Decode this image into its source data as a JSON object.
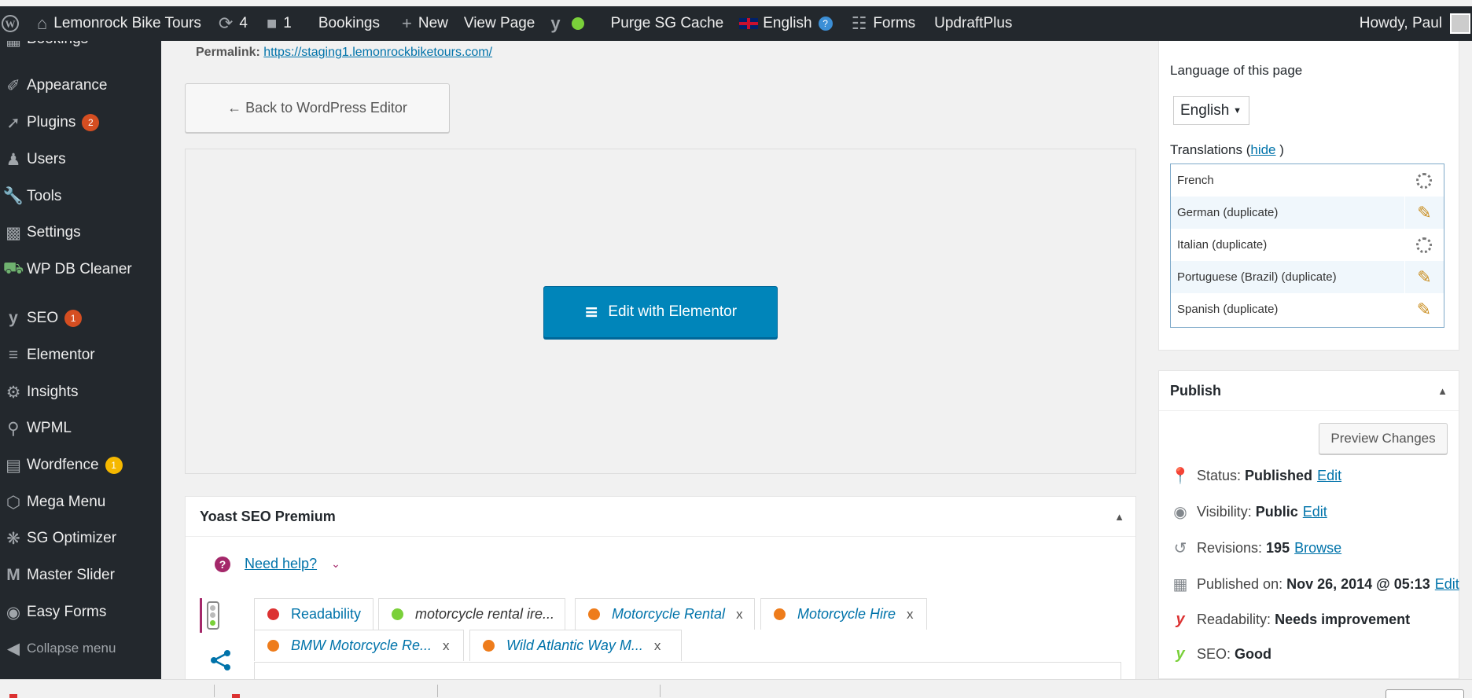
{
  "adminbar": {
    "site_name": "Lemonrock Bike Tours",
    "updates_count": "4",
    "comments_count": "1",
    "bookings": "Bookings",
    "new": "New",
    "view_page": "View Page",
    "purge": "Purge SG Cache",
    "language": "English",
    "forms": "Forms",
    "updraft": "UpdraftPlus",
    "howdy": "Howdy, Paul"
  },
  "sidebar": {
    "items": [
      {
        "label": "Bookings",
        "icon": "calendar-icon"
      },
      {
        "label": "Appearance",
        "icon": "paintbrush-icon"
      },
      {
        "label": "Plugins",
        "icon": "plugin-icon",
        "badge": "2"
      },
      {
        "label": "Users",
        "icon": "users-icon"
      },
      {
        "label": "Tools",
        "icon": "wrench-icon"
      },
      {
        "label": "Settings",
        "icon": "settings-icon"
      },
      {
        "label": "WP DB Cleaner",
        "icon": "database-icon"
      },
      {
        "label": "SEO",
        "icon": "yoast-icon",
        "badge": "1"
      },
      {
        "label": "Elementor",
        "icon": "elementor-icon"
      },
      {
        "label": "Insights",
        "icon": "insights-icon"
      },
      {
        "label": "WPML",
        "icon": "wpml-icon"
      },
      {
        "label": "Wordfence",
        "icon": "wordfence-icon",
        "badge": "1"
      },
      {
        "label": "Mega Menu",
        "icon": "megamenu-icon"
      },
      {
        "label": "SG Optimizer",
        "icon": "sg-icon"
      },
      {
        "label": "Master Slider",
        "icon": "slider-icon"
      },
      {
        "label": "Easy Forms",
        "icon": "forms-icon"
      },
      {
        "label": "Collapse menu",
        "icon": "collapse-icon"
      }
    ]
  },
  "main": {
    "permalink_label": "Permalink:",
    "permalink_url": "https://staging1.lemonrockbiketours.com/",
    "back_button": "← Back to WordPress Editor",
    "elementor_button": "Edit with Elementor"
  },
  "yoast": {
    "title": "Yoast SEO Premium",
    "need_help": "Need help?",
    "tabs": [
      {
        "label": "Readability",
        "color": "#dc3232"
      },
      {
        "label": "motorcycle rental ire...",
        "color": "#7ad03a"
      },
      {
        "label": "Motorcycle Rental",
        "color": "#ee7c1b",
        "close": "x"
      },
      {
        "label": "Motorcycle Hire",
        "color": "#ee7c1b",
        "close": "x"
      },
      {
        "label": "BMW Motorcycle Re...",
        "color": "#ee7c1b",
        "close": "x"
      },
      {
        "label": "Wild Atlantic Way M...",
        "color": "#ee7c1b",
        "close": "x"
      }
    ]
  },
  "language_box": {
    "title": "Language of this page",
    "selected": "English",
    "translations_label": "Translations",
    "hide_link": "hide",
    "close_paren": ")",
    "rows": [
      {
        "language": "French",
        "icon": "spinner-icon"
      },
      {
        "language": "German (duplicate)",
        "icon": "pencil-icon"
      },
      {
        "language": "Italian (duplicate)",
        "icon": "spinner-icon"
      },
      {
        "language": "Portuguese (Brazil) (duplicate)",
        "icon": "pencil-icon"
      },
      {
        "language": "Spanish (duplicate)",
        "icon": "pencil-icon"
      }
    ]
  },
  "publish": {
    "title": "Publish",
    "preview_button": "Preview Changes",
    "status_label": "Status:",
    "status_value": "Published",
    "visibility_label": "Visibility:",
    "visibility_value": "Public",
    "revisions_label": "Revisions:",
    "revisions_value": "195",
    "browse": "Browse",
    "published_label": "Published on:",
    "published_value": "Nov 26, 2014 @ 05:13",
    "edit": "Edit",
    "readability_label": "Readability:",
    "readability_value": "Needs improvement",
    "seo_label": "SEO:",
    "seo_value": "Good"
  }
}
